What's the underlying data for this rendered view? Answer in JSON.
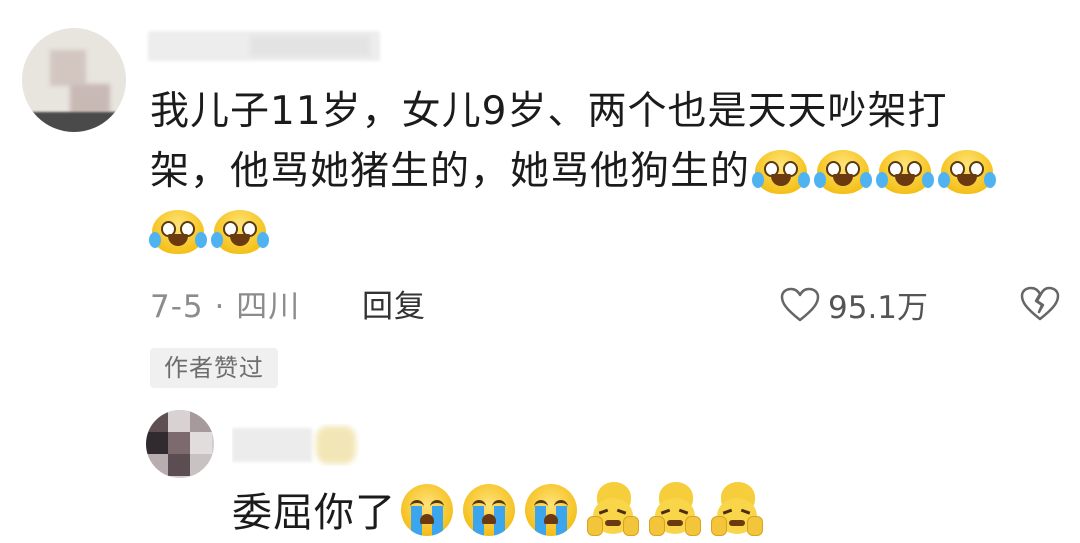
{
  "comment": {
    "text_line1": "我儿子11岁，女儿9岁、两个也是天天吵架打",
    "text_line2": "架，他骂她猪生的，她骂他狗生的",
    "inline_emojis": [
      "laugh-cry-emoji",
      "laugh-cry-emoji",
      "laugh-cry-emoji",
      "laugh-cry-emoji",
      "laugh-cry-emoji",
      "laugh-cry-emoji"
    ],
    "date_location": "7-5 · 四川",
    "reply_label": "回复",
    "like_count": "95.1万",
    "author_badge": "作者赞过"
  },
  "reply": {
    "text": "委屈你了",
    "inline_emojis": [
      "crying-emoji",
      "crying-emoji",
      "crying-emoji",
      "facepalm-emoji",
      "facepalm-emoji",
      "facepalm-emoji"
    ]
  },
  "colors": {
    "text": "#1b1b1b",
    "meta": "#8c8c8c",
    "badge_bg": "#f0f0f0",
    "emoji_yellow": "#f5c21b",
    "tear_blue": "#3ba5ee"
  }
}
